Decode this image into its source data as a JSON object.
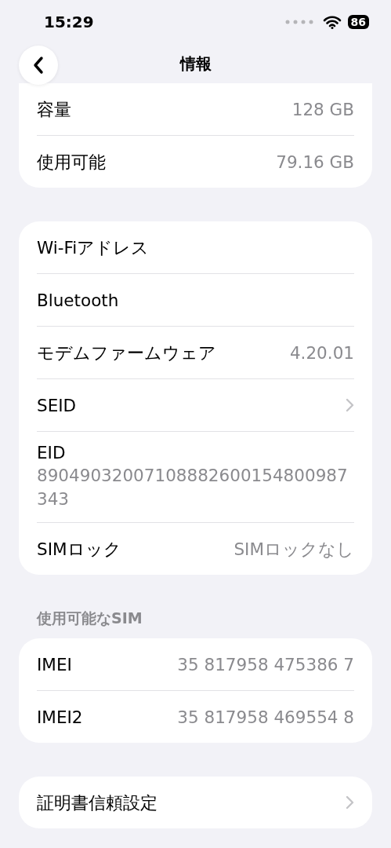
{
  "status_bar": {
    "time": "15:29",
    "battery": "86"
  },
  "nav": {
    "title": "情報"
  },
  "groups": [
    {
      "rows": [
        {
          "kind": "value",
          "label": "容量",
          "value": "128 GB"
        },
        {
          "kind": "value",
          "label": "使用可能",
          "value": "79.16 GB"
        }
      ]
    },
    {
      "rows": [
        {
          "kind": "value",
          "label": "Wi-Fiアドレス"
        },
        {
          "kind": "value",
          "label": "Bluetooth"
        },
        {
          "kind": "value",
          "label": "モデムファームウェア",
          "value": "4.20.01"
        },
        {
          "kind": "link",
          "label": "SEID"
        },
        {
          "kind": "stacked",
          "label": "EID",
          "value": "89049032007108882600154800987343"
        },
        {
          "kind": "value",
          "label": "SIMロック",
          "value": "SIMロックなし"
        }
      ]
    },
    {
      "header": "使用可能なSIM",
      "rows": [
        {
          "kind": "value",
          "label": "IMEI",
          "value": "35 817958 475386 7"
        },
        {
          "kind": "value",
          "label": "IMEI2",
          "value": "35 817958 469554 8"
        }
      ]
    },
    {
      "rows": [
        {
          "kind": "link",
          "label": "証明書信頼設定"
        }
      ]
    }
  ]
}
